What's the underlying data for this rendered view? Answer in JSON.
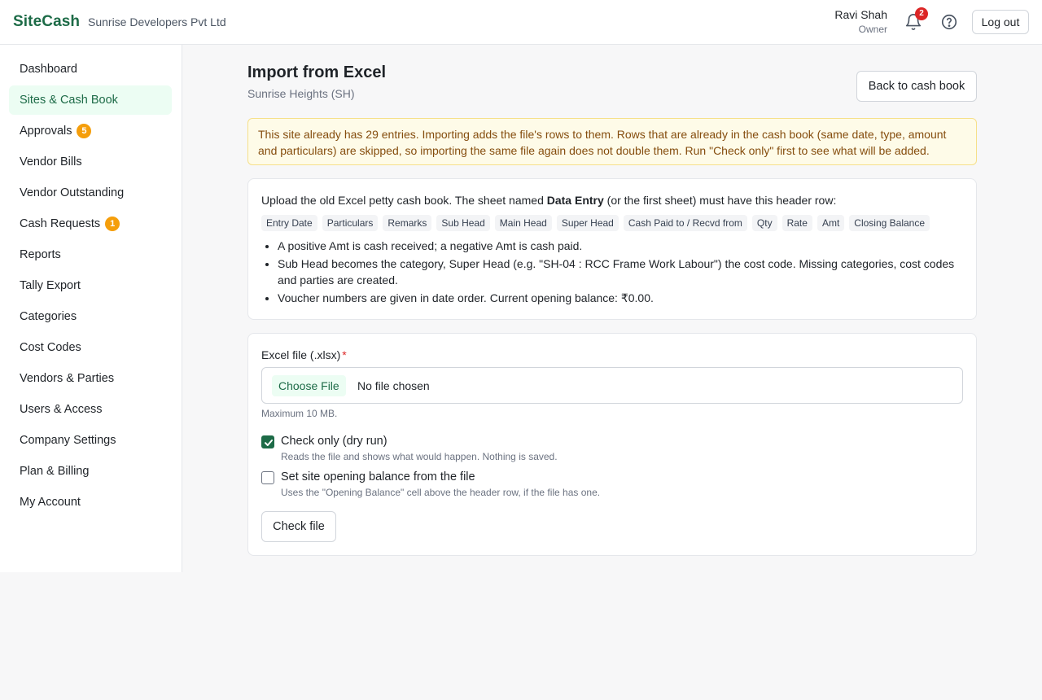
{
  "header": {
    "brand": "SiteCash",
    "company": "Sunrise Developers Pvt Ltd",
    "user_name": "Ravi Shah",
    "user_role": "Owner",
    "notification_count": "2",
    "logout_label": "Log out"
  },
  "sidebar": {
    "items": [
      {
        "label": "Dashboard",
        "badge": null,
        "active": false
      },
      {
        "label": "Sites & Cash Book",
        "badge": null,
        "active": true
      },
      {
        "label": "Approvals",
        "badge": "5",
        "active": false
      },
      {
        "label": "Vendor Bills",
        "badge": null,
        "active": false
      },
      {
        "label": "Vendor Outstanding",
        "badge": null,
        "active": false
      },
      {
        "label": "Cash Requests",
        "badge": "1",
        "active": false
      },
      {
        "label": "Reports",
        "badge": null,
        "active": false
      },
      {
        "label": "Tally Export",
        "badge": null,
        "active": false
      },
      {
        "label": "Categories",
        "badge": null,
        "active": false
      },
      {
        "label": "Cost Codes",
        "badge": null,
        "active": false
      },
      {
        "label": "Vendors & Parties",
        "badge": null,
        "active": false
      },
      {
        "label": "Users & Access",
        "badge": null,
        "active": false
      },
      {
        "label": "Company Settings",
        "badge": null,
        "active": false
      },
      {
        "label": "Plan & Billing",
        "badge": null,
        "active": false
      },
      {
        "label": "My Account",
        "badge": null,
        "active": false
      }
    ]
  },
  "main": {
    "title": "Import from Excel",
    "subtitle": "Sunrise Heights (SH)",
    "back_label": "Back to cash book",
    "warning": "This site already has 29 entries. Importing adds the file's rows to them. Rows that are already in the cash book (same date, type, amount and particulars) are skipped, so importing the same file again does not double them. Run \"Check only\" first to see what will be added.",
    "intro_before": "Upload the old Excel petty cash book. The sheet named ",
    "intro_sheet": "Data Entry",
    "intro_after": " (or the first sheet) must have this header row:",
    "columns": [
      "Entry Date",
      "Particulars",
      "Remarks",
      "Sub Head",
      "Main Head",
      "Super Head",
      "Cash Paid to / Recvd from",
      "Qty",
      "Rate",
      "Amt",
      "Closing Balance"
    ],
    "bullets": [
      "A positive Amt is cash received; a negative Amt is cash paid.",
      "Sub Head becomes the category, Super Head (e.g. \"SH-04 : RCC Frame Work Labour\") the cost code. Missing categories, cost codes and parties are created.",
      "Voucher numbers are given in date order. Current opening balance: ₹0.00."
    ],
    "form": {
      "file_label": "Excel file (.xlsx)",
      "required_mark": "*",
      "choose_label": "Choose File",
      "no_file": "No file chosen",
      "max_hint": "Maximum 10 MB.",
      "dry_run_label": "Check only (dry run)",
      "dry_run_help": "Reads the file and shows what would happen. Nothing is saved.",
      "dry_run_checked": true,
      "opening_label": "Set site opening balance from the file",
      "opening_help": "Uses the \"Opening Balance\" cell above the header row, if the file has one.",
      "opening_checked": false,
      "submit_label": "Check file"
    }
  },
  "colors": {
    "brand": "#1d6b47",
    "active_bg": "#ecfdf3",
    "badge": "#f59e0b",
    "alert": "#dc2626",
    "warning_bg": "#fefbe8",
    "warning_text": "#854d0e"
  }
}
